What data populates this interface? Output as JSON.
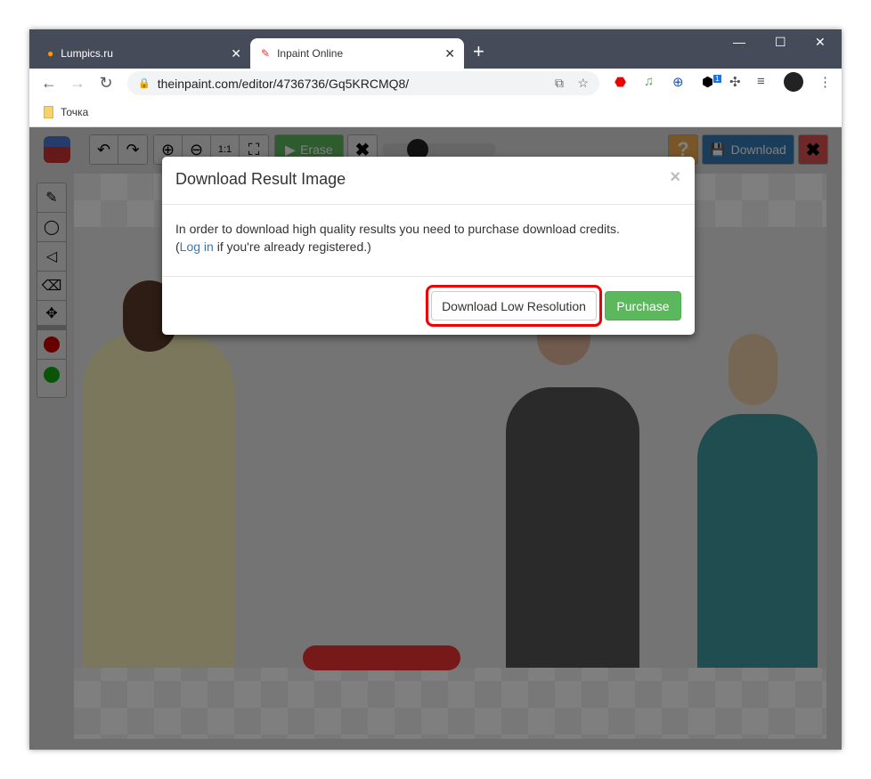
{
  "browser": {
    "tabs": [
      {
        "title": "Lumpics.ru",
        "active": false
      },
      {
        "title": "Inpaint Online",
        "active": true
      }
    ],
    "url": "theinpaint.com/editor/4736736/Gq5KRCMQ8/",
    "bookmarks": [
      "Точка"
    ],
    "extension_badge": "1"
  },
  "editor": {
    "erase_label": "Erase",
    "download_label": "Download",
    "help_label": "?"
  },
  "modal": {
    "title": "Download Result Image",
    "close": "×",
    "body_line1": "In order to download high quality results you need to purchase download credits.",
    "login_link": "Log in",
    "body_line2_rest": " if you're already registered.)",
    "body_line2_prefix": "(",
    "low_res_button": "Download Low Resolution",
    "purchase_button": "Purchase"
  },
  "colors": {
    "purchase": "#5cb85c",
    "highlight": "#e00000",
    "download": "#337ab7",
    "erase": "#5cb85c"
  }
}
